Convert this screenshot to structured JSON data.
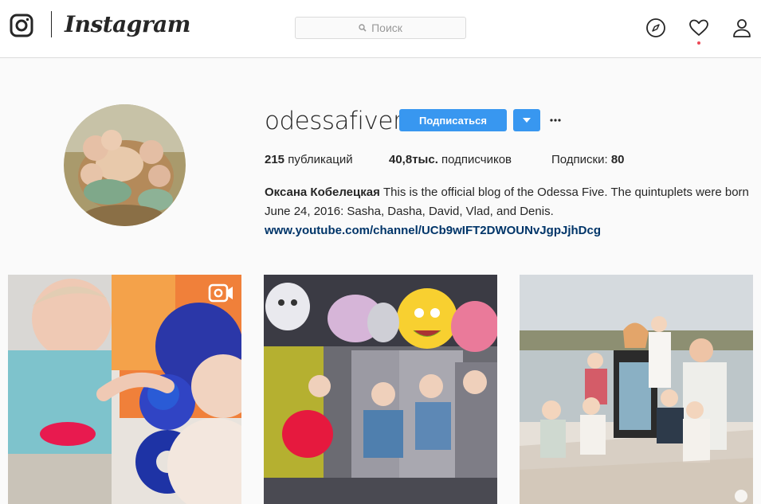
{
  "header": {
    "wordmark": "Instagram",
    "search_placeholder": "Поиск",
    "icons": [
      "instagram-logo-icon",
      "search-icon",
      "compass-icon",
      "heart-icon",
      "user-icon"
    ],
    "notification_color": "#ed4956"
  },
  "profile": {
    "username": "odessafiver",
    "follow_label": "Подписаться",
    "accent_color": "#3897f0",
    "stats": {
      "posts_count": "215",
      "posts_label": "публикаций",
      "followers_count": "40,8тыс.",
      "followers_label": "подписчиков",
      "following_label": "Подписки:",
      "following_count": "80"
    },
    "bio": {
      "full_name": "Оксана Кобелецкая",
      "text": "This is the official blog of the Odessa Five. The quintuplets were born June 24, 2016: Sasha, Dasha, David, Vlad, and Denis.",
      "link": "www.youtube.com/channel/UCb9wIFT2DWOUNvJgpJjhDcg"
    }
  },
  "posts": [
    {
      "type": "video",
      "icon": "video-icon"
    },
    {
      "type": "photo"
    },
    {
      "type": "photo"
    }
  ]
}
